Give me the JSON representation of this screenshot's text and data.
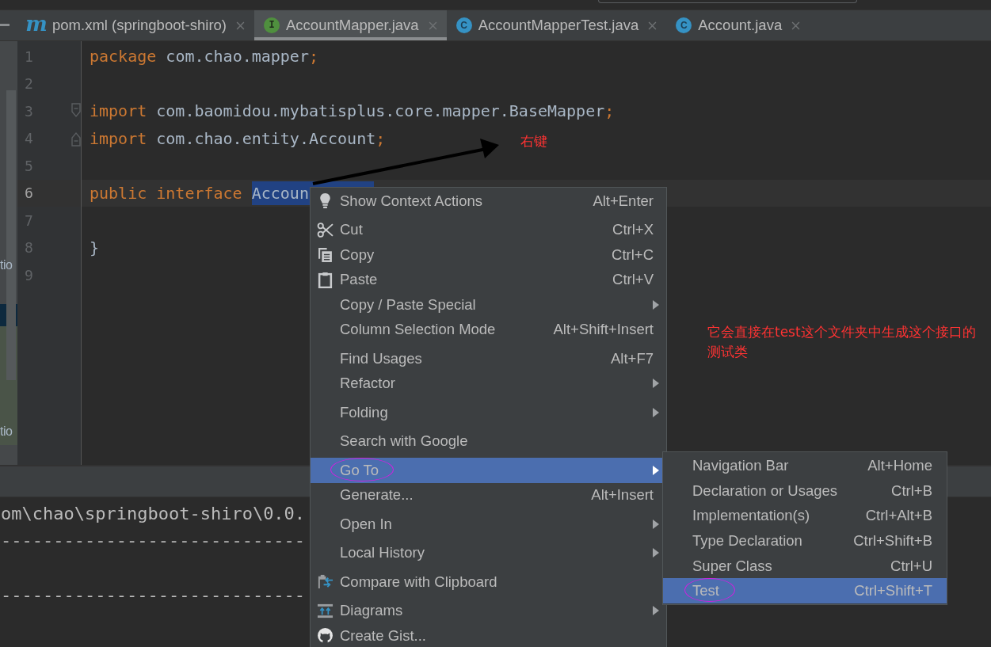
{
  "tabs": [
    {
      "icon_label": "m",
      "kind": "maven",
      "label": "pom.xml (springboot-shiro)",
      "selected": false
    },
    {
      "icon_label": "I",
      "kind": "interface",
      "label": "AccountMapper.java",
      "selected": true
    },
    {
      "icon_label": "C",
      "kind": "class",
      "label": "AccountMapperTest.java",
      "selected": false
    },
    {
      "icon_label": "C",
      "kind": "class",
      "label": "Account.java",
      "selected": false
    }
  ],
  "side_panel": {
    "texts": [
      "tio",
      "tio"
    ]
  },
  "editor": {
    "lines": [
      {
        "number": "1",
        "current": false,
        "fold_start": false,
        "fold_end": false,
        "tokens": [
          {
            "kind": "keyword",
            "text": "package"
          },
          {
            "kind": "plain",
            "text": " com.chao.mapper"
          },
          {
            "kind": "punct",
            "text": ";"
          }
        ]
      },
      {
        "number": "2",
        "current": false,
        "fold_start": false,
        "fold_end": false
      },
      {
        "number": "3",
        "current": false,
        "fold_start": true,
        "fold_end": false,
        "tokens": [
          {
            "kind": "keyword",
            "text": "import"
          },
          {
            "kind": "plain",
            "text": " com.baomidou.mybatisplus.core.mapper.BaseMapper"
          },
          {
            "kind": "punct",
            "text": ";"
          }
        ]
      },
      {
        "number": "4",
        "current": false,
        "fold_start": false,
        "fold_end": true,
        "tokens": [
          {
            "kind": "keyword",
            "text": "import"
          },
          {
            "kind": "plain",
            "text": " com.chao.entity.Account"
          },
          {
            "kind": "punct",
            "text": ";"
          }
        ]
      },
      {
        "number": "5",
        "current": false,
        "fold_start": false,
        "fold_end": false
      },
      {
        "number": "6",
        "current": true,
        "fold_start": false,
        "fold_end": false,
        "tokens": [
          {
            "kind": "keyword",
            "text": "public interface "
          },
          {
            "kind": "selected",
            "text": "Accoun"
          }
        ]
      },
      {
        "number": "7",
        "current": false,
        "fold_start": false,
        "fold_end": false
      },
      {
        "number": "8",
        "current": false,
        "fold_start": false,
        "fold_end": false,
        "tokens": [
          {
            "kind": "plain",
            "text": "}"
          }
        ]
      },
      {
        "number": "9",
        "current": false,
        "fold_start": false,
        "fold_end": false
      }
    ]
  },
  "console": {
    "lines": [
      {
        "kind": "text",
        "text": "om\\chao\\springboot-shiro\\0.0."
      },
      {
        "kind": "text",
        "text": "-----------------------------"
      },
      {
        "kind": "blank"
      },
      {
        "kind": "text",
        "text": "-----------------------------"
      }
    ]
  },
  "context_menu": {
    "items": [
      {
        "kind": "item",
        "label": "Show Context Actions",
        "shortcut": "Alt+Enter",
        "submenu": false,
        "selected": false,
        "circled": false
      },
      {
        "kind": "separator"
      },
      {
        "kind": "item",
        "label": "Cut",
        "shortcut": "Ctrl+X",
        "submenu": false,
        "selected": false,
        "circled": false
      },
      {
        "kind": "item",
        "label": "Copy",
        "shortcut": "Ctrl+C",
        "submenu": false,
        "selected": false,
        "circled": false
      },
      {
        "kind": "item",
        "label": "Paste",
        "shortcut": "Ctrl+V",
        "submenu": false,
        "selected": false,
        "circled": false
      },
      {
        "kind": "item",
        "label": "Copy / Paste Special",
        "submenu": true,
        "selected": false,
        "circled": false
      },
      {
        "kind": "item",
        "label": "Column Selection Mode",
        "shortcut": "Alt+Shift+Insert",
        "submenu": false,
        "selected": false,
        "circled": false
      },
      {
        "kind": "separator"
      },
      {
        "kind": "item",
        "label": "Find Usages",
        "shortcut": "Alt+F7",
        "submenu": false,
        "selected": false,
        "circled": false
      },
      {
        "kind": "item",
        "label": "Refactor",
        "submenu": true,
        "selected": false,
        "circled": false
      },
      {
        "kind": "separator"
      },
      {
        "kind": "item",
        "label": "Folding",
        "submenu": true,
        "selected": false,
        "circled": false
      },
      {
        "kind": "separator"
      },
      {
        "kind": "item",
        "label": "Search with Google",
        "submenu": false,
        "selected": false,
        "circled": false
      },
      {
        "kind": "separator"
      },
      {
        "kind": "item",
        "label": "Go To",
        "submenu": true,
        "selected": true,
        "circled": true
      },
      {
        "kind": "item",
        "label": "Generate...",
        "shortcut": "Alt+Insert",
        "submenu": false,
        "selected": false,
        "circled": false
      },
      {
        "kind": "separator"
      },
      {
        "kind": "item",
        "label": "Open In",
        "submenu": true,
        "selected": false,
        "circled": false
      },
      {
        "kind": "separator"
      },
      {
        "kind": "item",
        "label": "Local History",
        "submenu": true,
        "selected": false,
        "circled": false
      },
      {
        "kind": "separator"
      },
      {
        "kind": "item",
        "label": "Compare with Clipboard",
        "submenu": false,
        "selected": false,
        "circled": false
      },
      {
        "kind": "separator"
      },
      {
        "kind": "item",
        "label": "Diagrams",
        "submenu": true,
        "selected": false,
        "circled": false
      },
      {
        "kind": "item",
        "label": "Create Gist...",
        "submenu": false,
        "selected": false,
        "circled": false
      }
    ]
  },
  "submenu": {
    "items": [
      {
        "label": "Navigation Bar",
        "shortcut": "Alt+Home",
        "selected": false,
        "circled": false
      },
      {
        "label": "Declaration or Usages",
        "shortcut": "Ctrl+B",
        "selected": false,
        "circled": false
      },
      {
        "label": "Implementation(s)",
        "shortcut": "Ctrl+Alt+B",
        "selected": false,
        "circled": false
      },
      {
        "label": "Type Declaration",
        "shortcut": "Ctrl+Shift+B",
        "selected": false,
        "circled": false
      },
      {
        "label": "Super Class",
        "shortcut": "Ctrl+U",
        "selected": false,
        "circled": false
      },
      {
        "label": "Test",
        "shortcut": "Ctrl+Shift+T",
        "selected": true,
        "circled": true
      }
    ]
  },
  "annotations": {
    "arrow_label": "右键",
    "note": "它会直接在test这个文件夹中生成这个接口的测试类"
  }
}
